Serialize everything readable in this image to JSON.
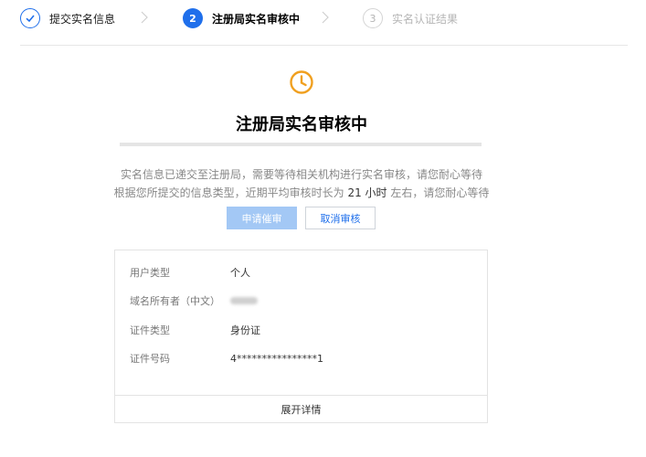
{
  "stepper": {
    "steps": [
      {
        "number": "",
        "label": "提交实名信息",
        "state": "done"
      },
      {
        "number": "2",
        "label": "注册局实名审核中",
        "state": "active"
      },
      {
        "number": "3",
        "label": "实名认证结果",
        "state": "todo"
      }
    ]
  },
  "status": {
    "title": "注册局实名审核中",
    "line1": "实名信息已递交至注册局，需要等待相关机构进行实名审核，请您耐心等待",
    "line2_before": "根据您所提交的信息类型，近期平均审核时长为 ",
    "line2_highlight": "21 小时",
    "line2_after": " 左右，请您耐心等待",
    "accent_color": "#f0a020"
  },
  "actions": {
    "urge_label": "申请催审",
    "cancel_label": "取消审核"
  },
  "info": {
    "rows": [
      {
        "key": "用户类型",
        "value": "个人"
      },
      {
        "key": "域名所有者（中文）",
        "value": ""
      },
      {
        "key": "证件类型",
        "value": "身份证"
      },
      {
        "key": "证件号码",
        "value": "4****************1"
      }
    ],
    "expand_label": "展开详情"
  },
  "colors": {
    "brand": "#1f6feb",
    "primary_disabled": "#a3c8f5"
  }
}
